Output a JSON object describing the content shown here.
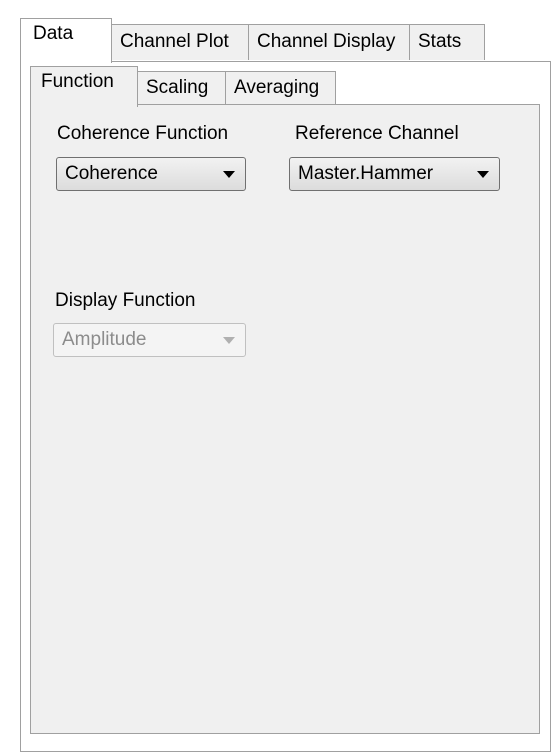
{
  "outer_tabs": [
    "Data",
    "Channel Plot",
    "Channel Display",
    "Stats"
  ],
  "inner_tabs": [
    "Function",
    "Scaling",
    "Averaging"
  ],
  "coherence_function": {
    "label": "Coherence Function",
    "value": "Coherence"
  },
  "reference_channel": {
    "label": "Reference Channel",
    "value": "Master.Hammer"
  },
  "display_function": {
    "label": "Display Function",
    "value": "Amplitude",
    "enabled": false
  }
}
